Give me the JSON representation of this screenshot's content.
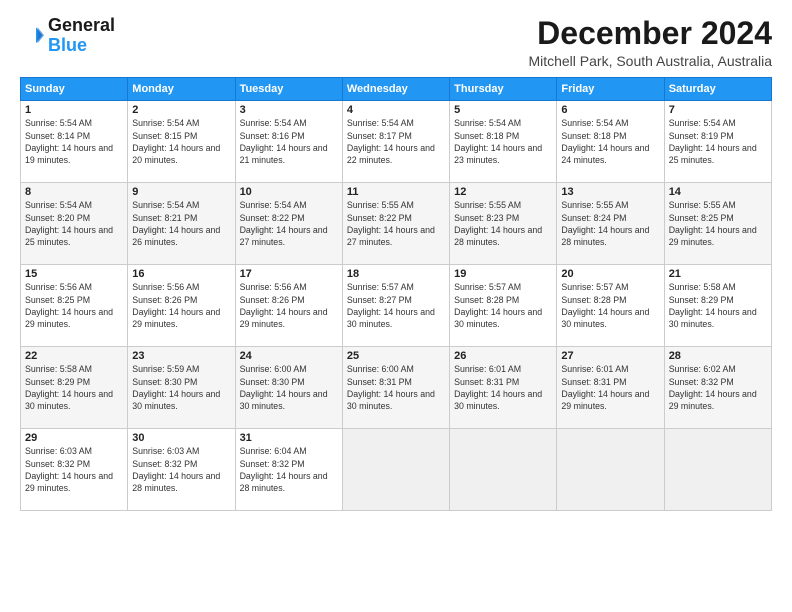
{
  "logo": {
    "line1": "General",
    "line2": "Blue"
  },
  "title": "December 2024",
  "subtitle": "Mitchell Park, South Australia, Australia",
  "headers": [
    "Sunday",
    "Monday",
    "Tuesday",
    "Wednesday",
    "Thursday",
    "Friday",
    "Saturday"
  ],
  "weeks": [
    [
      {
        "day": "1",
        "sunrise": "5:54 AM",
        "sunset": "8:14 PM",
        "daylight": "14 hours and 19 minutes."
      },
      {
        "day": "2",
        "sunrise": "5:54 AM",
        "sunset": "8:15 PM",
        "daylight": "14 hours and 20 minutes."
      },
      {
        "day": "3",
        "sunrise": "5:54 AM",
        "sunset": "8:16 PM",
        "daylight": "14 hours and 21 minutes."
      },
      {
        "day": "4",
        "sunrise": "5:54 AM",
        "sunset": "8:17 PM",
        "daylight": "14 hours and 22 minutes."
      },
      {
        "day": "5",
        "sunrise": "5:54 AM",
        "sunset": "8:18 PM",
        "daylight": "14 hours and 23 minutes."
      },
      {
        "day": "6",
        "sunrise": "5:54 AM",
        "sunset": "8:18 PM",
        "daylight": "14 hours and 24 minutes."
      },
      {
        "day": "7",
        "sunrise": "5:54 AM",
        "sunset": "8:19 PM",
        "daylight": "14 hours and 25 minutes."
      }
    ],
    [
      {
        "day": "8",
        "sunrise": "5:54 AM",
        "sunset": "8:20 PM",
        "daylight": "14 hours and 25 minutes."
      },
      {
        "day": "9",
        "sunrise": "5:54 AM",
        "sunset": "8:21 PM",
        "daylight": "14 hours and 26 minutes."
      },
      {
        "day": "10",
        "sunrise": "5:54 AM",
        "sunset": "8:22 PM",
        "daylight": "14 hours and 27 minutes."
      },
      {
        "day": "11",
        "sunrise": "5:55 AM",
        "sunset": "8:22 PM",
        "daylight": "14 hours and 27 minutes."
      },
      {
        "day": "12",
        "sunrise": "5:55 AM",
        "sunset": "8:23 PM",
        "daylight": "14 hours and 28 minutes."
      },
      {
        "day": "13",
        "sunrise": "5:55 AM",
        "sunset": "8:24 PM",
        "daylight": "14 hours and 28 minutes."
      },
      {
        "day": "14",
        "sunrise": "5:55 AM",
        "sunset": "8:25 PM",
        "daylight": "14 hours and 29 minutes."
      }
    ],
    [
      {
        "day": "15",
        "sunrise": "5:56 AM",
        "sunset": "8:25 PM",
        "daylight": "14 hours and 29 minutes."
      },
      {
        "day": "16",
        "sunrise": "5:56 AM",
        "sunset": "8:26 PM",
        "daylight": "14 hours and 29 minutes."
      },
      {
        "day": "17",
        "sunrise": "5:56 AM",
        "sunset": "8:26 PM",
        "daylight": "14 hours and 29 minutes."
      },
      {
        "day": "18",
        "sunrise": "5:57 AM",
        "sunset": "8:27 PM",
        "daylight": "14 hours and 30 minutes."
      },
      {
        "day": "19",
        "sunrise": "5:57 AM",
        "sunset": "8:28 PM",
        "daylight": "14 hours and 30 minutes."
      },
      {
        "day": "20",
        "sunrise": "5:57 AM",
        "sunset": "8:28 PM",
        "daylight": "14 hours and 30 minutes."
      },
      {
        "day": "21",
        "sunrise": "5:58 AM",
        "sunset": "8:29 PM",
        "daylight": "14 hours and 30 minutes."
      }
    ],
    [
      {
        "day": "22",
        "sunrise": "5:58 AM",
        "sunset": "8:29 PM",
        "daylight": "14 hours and 30 minutes."
      },
      {
        "day": "23",
        "sunrise": "5:59 AM",
        "sunset": "8:30 PM",
        "daylight": "14 hours and 30 minutes."
      },
      {
        "day": "24",
        "sunrise": "6:00 AM",
        "sunset": "8:30 PM",
        "daylight": "14 hours and 30 minutes."
      },
      {
        "day": "25",
        "sunrise": "6:00 AM",
        "sunset": "8:31 PM",
        "daylight": "14 hours and 30 minutes."
      },
      {
        "day": "26",
        "sunrise": "6:01 AM",
        "sunset": "8:31 PM",
        "daylight": "14 hours and 30 minutes."
      },
      {
        "day": "27",
        "sunrise": "6:01 AM",
        "sunset": "8:31 PM",
        "daylight": "14 hours and 29 minutes."
      },
      {
        "day": "28",
        "sunrise": "6:02 AM",
        "sunset": "8:32 PM",
        "daylight": "14 hours and 29 minutes."
      }
    ],
    [
      {
        "day": "29",
        "sunrise": "6:03 AM",
        "sunset": "8:32 PM",
        "daylight": "14 hours and 29 minutes."
      },
      {
        "day": "30",
        "sunrise": "6:03 AM",
        "sunset": "8:32 PM",
        "daylight": "14 hours and 28 minutes."
      },
      {
        "day": "31",
        "sunrise": "6:04 AM",
        "sunset": "8:32 PM",
        "daylight": "14 hours and 28 minutes."
      },
      null,
      null,
      null,
      null
    ]
  ]
}
